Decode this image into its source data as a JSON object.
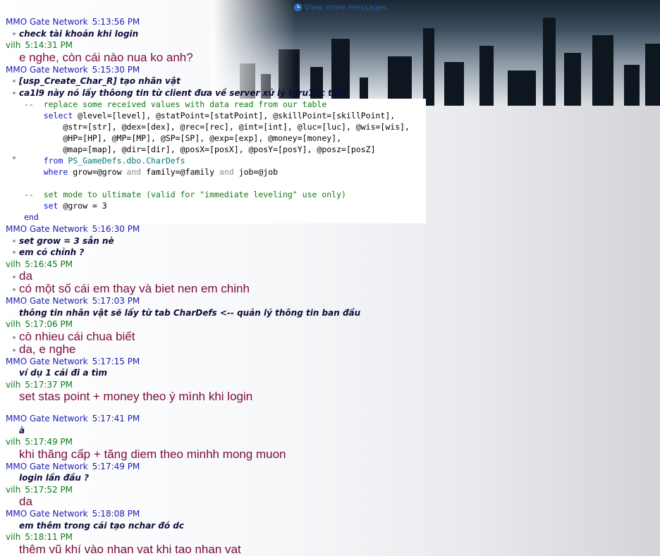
{
  "view_more": "View more messages",
  "senders": {
    "mmo": "MMO Gate Network",
    "vilh": "vilh"
  },
  "messages": [
    {
      "sender": "mmo",
      "time": "5:13:56 PM",
      "lines": [
        {
          "text": "check tài khoản khi login",
          "dot": true
        }
      ]
    },
    {
      "sender": "vilh",
      "time": "5:14:31 PM",
      "lines": [
        {
          "text": "e nghe, còn cái nào nua ko anh?",
          "dot": false
        }
      ]
    },
    {
      "sender": "mmo",
      "time": "5:15:30 PM",
      "lines": [
        {
          "text": "[usp_Create_Char_R] tạo nhân vật",
          "dot": true
        },
        {
          "text": "ca1l9 này nó lấy thôong tin từ client đưa về server xử lý tyru75c tiếp",
          "dot": true
        }
      ],
      "code": [
        "--  replace some received values with data read from our table",
        "    select @level=[level], @statPoint=[statPoint], @skillPoint=[skillPoint],",
        "        @str=[str], @dex=[dex], @rec=[rec], @int=[int], @luc=[luc], @wis=[wis],",
        "        @HP=[HP], @MP=[MP], @SP=[SP], @exp=[exp], @money=[money],",
        "        @map=[map], @dir=[dir], @posX=[posX], @posY=[posY], @posz=[posZ]",
        "    from PS_GameDefs.dbo.CharDefs",
        "    where grow=@grow and family=@family and job=@job",
        "",
        "--  set mode to ultimate (valid for \"immediate leveling\" use only)",
        "    set @grow = 3",
        "end"
      ]
    },
    {
      "sender": "mmo",
      "time": "5:16:30 PM",
      "lines": [
        {
          "text": "set grow = 3 sẵn nè",
          "dot": true
        },
        {
          "text": "em có chỉnh ?",
          "dot": true
        }
      ]
    },
    {
      "sender": "vilh",
      "time": "5:16:45 PM",
      "lines": [
        {
          "text": "da",
          "dot": true
        },
        {
          "text": "có một số cái em thay và biet nen em chinh",
          "dot": true
        }
      ]
    },
    {
      "sender": "mmo",
      "time": "5:17:03 PM",
      "lines": [
        {
          "text": "thông tin nhân vật sẽ lấy từ tab CharDefs <-- quản lý thông tin ban đầu",
          "dot": false
        }
      ]
    },
    {
      "sender": "vilh",
      "time": "5:17:06 PM",
      "lines": [
        {
          "text": "cò nhieu cái chua biết",
          "dot": true
        },
        {
          "text": "da, e nghe",
          "dot": true
        }
      ]
    },
    {
      "sender": "mmo",
      "time": "5:17:15 PM",
      "lines": [
        {
          "text": "ví dụ 1 cái đi a tìm",
          "dot": false
        }
      ]
    },
    {
      "sender": "vilh",
      "time": "5:17:37 PM",
      "lines": [
        {
          "text": "set stas point + money theo ý mình khi login",
          "dot": false
        }
      ],
      "gap": true
    },
    {
      "sender": "mmo",
      "time": "5:17:41 PM",
      "lines": [
        {
          "text": "à",
          "dot": false
        }
      ]
    },
    {
      "sender": "vilh",
      "time": "5:17:49 PM",
      "lines": [
        {
          "text": "khi thăng cấp + tăng diem theo minhh mong muon",
          "dot": false
        }
      ]
    },
    {
      "sender": "mmo",
      "time": "5:17:49 PM",
      "lines": [
        {
          "text": "login lần đầu ?",
          "dot": false
        }
      ]
    },
    {
      "sender": "vilh",
      "time": "5:17:52 PM",
      "lines": [
        {
          "text": "da",
          "dot": false
        }
      ]
    },
    {
      "sender": "mmo",
      "time": "5:18:08 PM",
      "lines": [
        {
          "text": "em thêm trong cái tạo nchar đó dc",
          "dot": false
        }
      ]
    },
    {
      "sender": "vilh",
      "time": "5:18:11 PM",
      "lines": [
        {
          "text": "thêm vũ khí vào nhan vat khi tao nhan vat",
          "dot": false
        }
      ]
    }
  ]
}
